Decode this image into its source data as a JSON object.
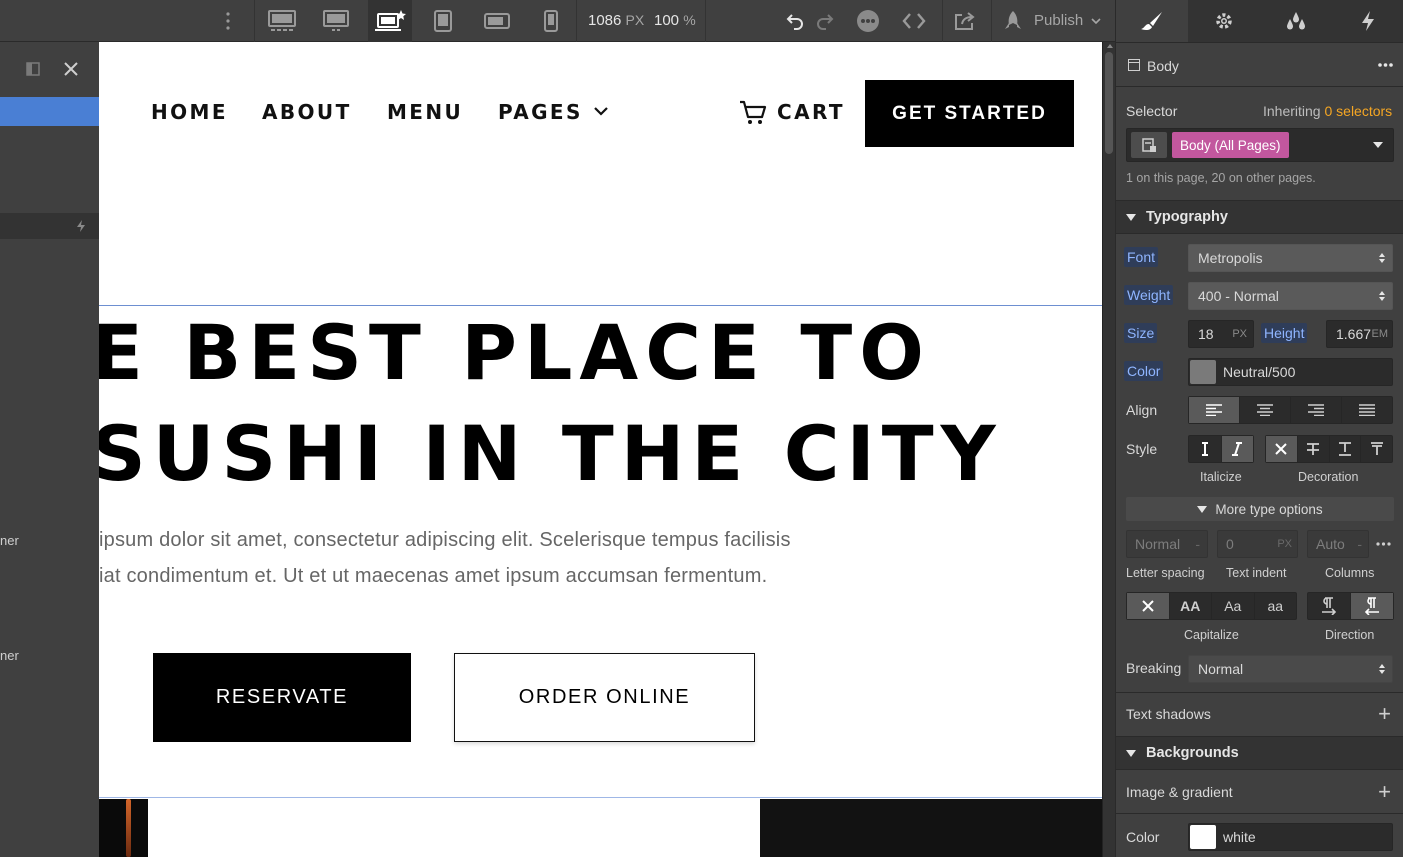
{
  "toolbar": {
    "width_value": "1086",
    "width_unit": "PX",
    "zoom_value": "100",
    "zoom_unit": "%",
    "publish_label": "Publish"
  },
  "canvas": {
    "nav": {
      "home": "HOME",
      "about": "ABOUT",
      "menu": "MENU",
      "pages": "PAGES",
      "cart": "CART",
      "cta": "GET STARTED"
    },
    "hero": {
      "line1": "E BEST PLACE TO",
      "line2": "SUSHI IN THE CITY",
      "para1": "ipsum dolor sit amet, consectetur adipiscing elit. Scelerisque tempus facilisis",
      "para2": "iat condimentum et. Ut et ut maecenas amet ipsum accumsan fermentum."
    },
    "buttons": {
      "reservate": "RESERVATE",
      "order": "ORDER ONLINE"
    }
  },
  "left_panel": {
    "fragment1": "ner",
    "fragment2": "ner"
  },
  "style_panel": {
    "element_name": "Body",
    "selector_label": "Selector",
    "inheriting_prefix": "Inheriting",
    "inheriting_count": "0 selectors",
    "selector_tag": "Body (All Pages)",
    "usage_note": "1 on this page, 20 on other pages.",
    "typography": {
      "title": "Typography",
      "font_label": "Font",
      "font_value": "Metropolis",
      "weight_label": "Weight",
      "weight_value": "400 - Normal",
      "size_label": "Size",
      "size_value": "18",
      "size_unit": "PX",
      "height_label": "Height",
      "height_value": "1.667",
      "height_unit": "EM",
      "color_label": "Color",
      "color_value": "Neutral/500",
      "color_swatch": "#7a7a7a",
      "align_label": "Align",
      "style_label": "Style",
      "italicize_label": "Italicize",
      "decoration_label": "Decoration",
      "more_options": "More type options",
      "letter_spacing_value": "Normal",
      "letter_spacing_label": "Letter spacing",
      "text_indent_value": "0",
      "text_indent_unit": "PX",
      "text_indent_label": "Text indent",
      "columns_value": "Auto",
      "columns_label": "Columns",
      "capitalize_label": "Capitalize",
      "direction_label": "Direction",
      "breaking_label": "Breaking",
      "breaking_value": "Normal",
      "text_shadows_label": "Text shadows"
    },
    "backgrounds": {
      "title": "Backgrounds",
      "image_gradient_label": "Image & gradient",
      "color_label": "Color",
      "color_value": "white",
      "color_swatch": "#ffffff"
    }
  },
  "colors": {
    "accent_blue": "#4a7fd4",
    "selector_pink": "#c2579e",
    "inheriting_orange": "#f5a623"
  }
}
